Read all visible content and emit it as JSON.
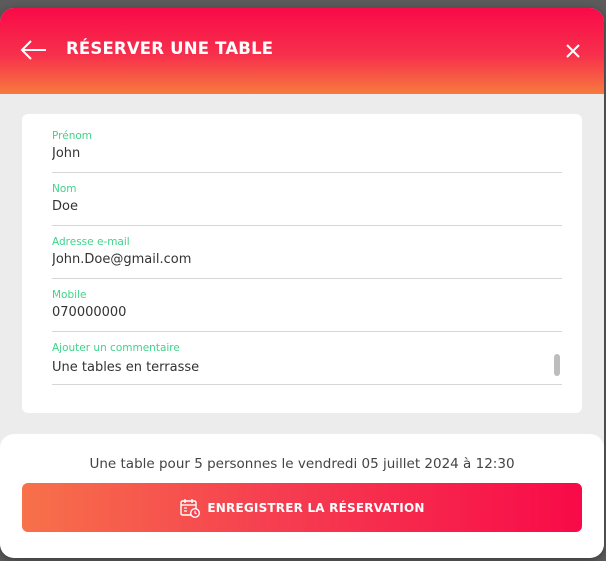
{
  "header": {
    "title": "RÉSERVER UNE TABLE",
    "back_icon": "arrow-left-icon",
    "close_icon": "close-icon"
  },
  "form": {
    "fields": [
      {
        "label": "Prénom",
        "value": "John"
      },
      {
        "label": "Nom",
        "value": "Doe"
      },
      {
        "label": "Adresse e-mail",
        "value": "John.Doe@gmail.com"
      },
      {
        "label": "Mobile",
        "value": "070000000"
      },
      {
        "label": "Ajouter un commentaire",
        "value": "Une tables en terrasse"
      }
    ]
  },
  "footer": {
    "summary": "Une table pour 5 personnes le vendredi 05 juillet 2024 à 12:30",
    "save_label": "ENREGISTRER LA RÉSERVATION",
    "save_icon": "calendar-clock-icon"
  },
  "colors": {
    "brand": "#f80a48",
    "accent_orange": "#f7714a",
    "field_label": "#3fd38a"
  }
}
